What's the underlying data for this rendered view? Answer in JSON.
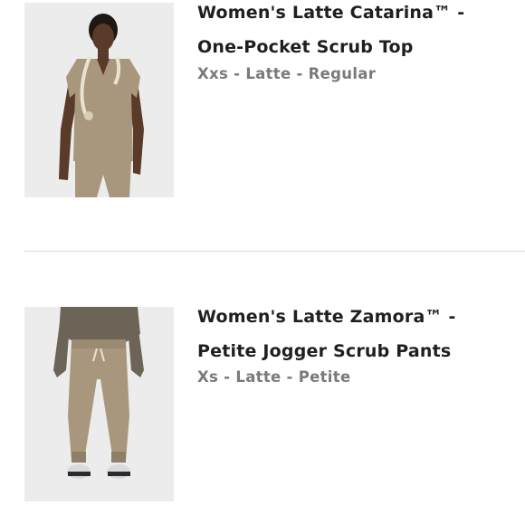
{
  "items": [
    {
      "title": "Women's Latte Catarina™ - One-Pocket Scrub Top",
      "variant": "Xxs - Latte - Regular",
      "image_icon": "product-photo-scrub-top"
    },
    {
      "title": "Women's Latte Zamora™ - Petite Jogger Scrub Pants",
      "variant": "Xs - Latte - Petite",
      "image_icon": "product-photo-jogger-pants"
    }
  ],
  "colors": {
    "latte": "#a8977d",
    "title": "#1f1f1f",
    "variant": "#7a7a7a",
    "thumb_bg": "#ececec"
  }
}
